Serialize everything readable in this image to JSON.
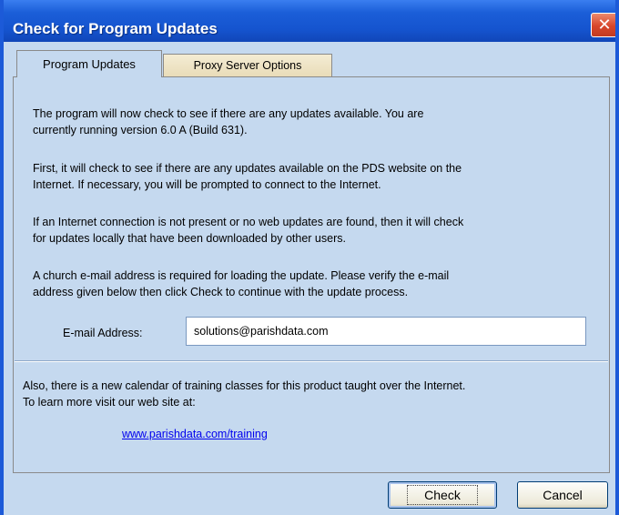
{
  "window": {
    "title": "Check for Program Updates",
    "close_glyph": "✕"
  },
  "tabs": [
    {
      "label": "Program Updates",
      "active": true
    },
    {
      "label": "Proxy Server Options",
      "active": false
    }
  ],
  "content": {
    "para1": [
      "The program will now check to see if there are any updates available.  You are",
      "currently running version 6.0 A  (Build 631)."
    ],
    "para2": [
      "First, it will check to see if there are any updates available on the PDS website on the",
      "Internet.  If necessary, you will be prompted to connect to the Internet."
    ],
    "para3": [
      "If an Internet connection is not present or no web updates are found, then it will check",
      "for updates locally that have been downloaded by other users."
    ],
    "para4": [
      "A church e-mail address is required for loading the update.  Please verify the e-mail",
      "address given below then click Check to continue with the update process."
    ],
    "email_label": "E-mail Address:",
    "email_value": "solutions@parishdata.com",
    "para5": [
      "Also, there is a new calendar of training classes for this product taught over the Internet.",
      "To learn more visit our web site at:"
    ],
    "training_link": "www.parishdata.com/training"
  },
  "buttons": {
    "check": "Check",
    "cancel": "Cancel"
  },
  "colors": {
    "titlebar": "#1554cf",
    "dialog_bg": "#c5d9ef",
    "link": "#0000ee",
    "close": "#d8462a"
  }
}
